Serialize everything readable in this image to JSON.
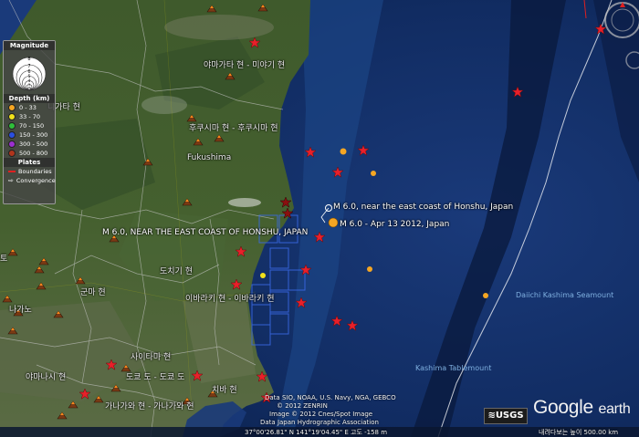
{
  "legend": {
    "magnitude_title": "Magnitude",
    "magnitude_values": [
      "8",
      "7",
      "6",
      "5",
      "4",
      "3",
      "2"
    ],
    "depth_title": "Depth (km)",
    "depth_items": [
      {
        "label": "0 - 33",
        "color": "#f5a623"
      },
      {
        "label": "33 - 70",
        "color": "#f2e21a"
      },
      {
        "label": "70 - 150",
        "color": "#2fbf3a"
      },
      {
        "label": "150 - 300",
        "color": "#2a4fe0"
      },
      {
        "label": "300 - 500",
        "color": "#9b2fd0"
      },
      {
        "label": "500 - 800",
        "color": "#b0351c"
      }
    ],
    "plates_title": "Plates",
    "plates_items": [
      {
        "label": "Boundaries",
        "color": "#e02020"
      },
      {
        "label": "Convergence",
        "color": "#ffffff"
      }
    ]
  },
  "places": [
    "야마가타 현 - 미야기 현",
    "니가타 현",
    "후쿠시마 현 - 후쿠시마 현",
    "Fukushima",
    "도치기 현",
    "이바라키 현 - 이바라키 현",
    "군마 현",
    "사이타마 현",
    "도쿄 도 - 도쿄 도",
    "야마나시 현",
    "가나가와 현 - 가나가와 현",
    "치바 현",
    "토",
    "나가노"
  ],
  "sea_labels": [
    "Daiichi Kashima Seamount",
    "Kashima Tablemount"
  ],
  "quake_labels": {
    "near_coast": "M 6.0, near the east coast of Honshu, Japan",
    "apr13": "M 6.0 - Apr 13 2012, Japan",
    "east_coast": "M 6.0, NEAR THE EAST COAST OF HONSHU, JAPAN"
  },
  "credits": {
    "data_line1": "Data SIO, NOAA, U.S. Navy, NGA, GEBCO",
    "data_line2": "© 2012 ZENRIN",
    "data_line3": "Image © 2012 Cnes/Spot Image",
    "data_line4": "Data Japan Hydrographic Association"
  },
  "branding": {
    "usgs": "≋USGS",
    "google": "Google",
    "earth": "earth"
  },
  "status_bar": {
    "coords": "37°00'26.81\" N 141°19'04.45\" E   고도   -158 m",
    "eye_alt": "내려다보는 높이  500.00 km"
  },
  "colors": {
    "star": "#e8202a",
    "depth_0_33": "#f5a623",
    "depth_33_70": "#f2e21a",
    "volcano": "#e05a10"
  }
}
